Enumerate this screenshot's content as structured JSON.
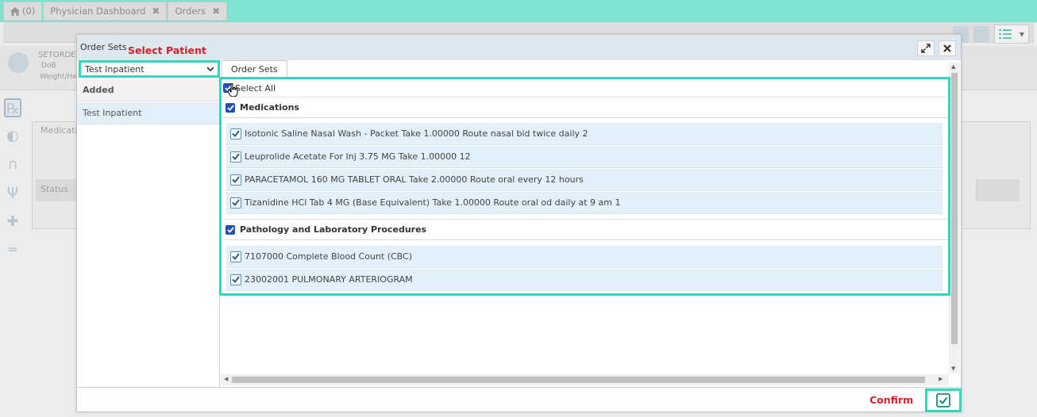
{
  "tabs": [
    {
      "label": "(0)",
      "icon": "home-icon"
    },
    {
      "label": "Physician Dashboard"
    },
    {
      "label": "Orders"
    }
  ],
  "background": {
    "patient_name": "SETORDE",
    "patient_dob": "DoB",
    "patient_weight": "Weight/He",
    "card_title": "Medicatio",
    "card_status": "Status"
  },
  "dialog": {
    "title": "Order Sets",
    "annotation_select_patient": "Select Patient",
    "patient_select_value": "Test Inpatient",
    "added_header": "Added",
    "added_item": "Test Inpatient",
    "tab_label": "Order Sets",
    "select_all_label": "Select All",
    "sections": [
      {
        "title": "Medications",
        "items": [
          "Isotonic Saline Nasal Wash - Packet Take 1.00000 Route nasal bid twice daily 2",
          "Leuprolide Acetate For Inj 3.75 MG Take 1.00000 12",
          "PARACETAMOL 160 MG TABLET ORAL Take 2.00000 Route oral every 12 hours",
          "Tizanidine HCl Tab 4 MG (Base Equivalent) Take 1.00000 Route oral od daily at 9 am 1"
        ]
      },
      {
        "title": "Pathology and Laboratory Procedures",
        "items": [
          "7107000 Complete Blood Count (CBC)",
          "23002001 PULMONARY ARTERIOGRAM"
        ]
      }
    ],
    "annotation_confirm": "Confirm"
  },
  "colors": {
    "highlight": "#2fd6c0",
    "annotation": "#d2202e",
    "checkbox": "#2450b3",
    "row_bg": "#e3f0f9"
  }
}
